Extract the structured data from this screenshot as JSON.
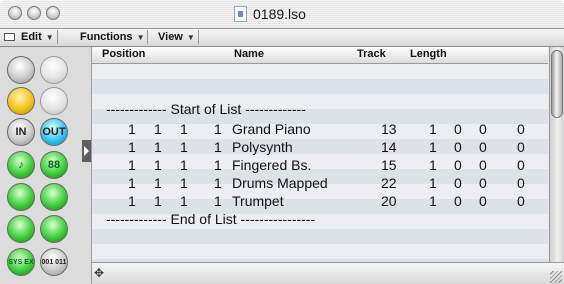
{
  "window": {
    "title": "0189.lso"
  },
  "menubar": {
    "items": [
      {
        "label": "Edit"
      },
      {
        "label": "Functions"
      },
      {
        "label": "View"
      }
    ]
  },
  "toolbar": {
    "buttons": [
      {
        "name": "walk-icon",
        "label": "",
        "color": "gray"
      },
      {
        "name": "up-arrow-icon",
        "label": "",
        "color": "gray-light"
      },
      {
        "name": "catch-icon",
        "label": "",
        "color": "yellow"
      },
      {
        "name": "down-arrow-icon",
        "label": "",
        "color": "gray-light"
      },
      {
        "name": "midi-in-icon",
        "label": "IN",
        "color": "gray"
      },
      {
        "name": "midi-out-icon",
        "label": "OUT",
        "color": "cyan"
      },
      {
        "name": "note-icon",
        "label": "♪",
        "color": "green"
      },
      {
        "name": "program-icon",
        "label": "88",
        "color": "green"
      },
      {
        "name": "pitchbend-icon",
        "label": "",
        "color": "green"
      },
      {
        "name": "controller-icon",
        "label": "",
        "color": "green"
      },
      {
        "name": "aftertouch-icon",
        "label": "",
        "color": "green"
      },
      {
        "name": "polypressure-icon",
        "label": "",
        "color": "green"
      },
      {
        "name": "sysex-icon",
        "label": "SYS EX",
        "color": "green"
      },
      {
        "name": "binary-icon",
        "label": "001 011",
        "color": "gray"
      }
    ]
  },
  "header": {
    "position": "Position",
    "name": "Name",
    "track": "Track",
    "length": "Length"
  },
  "list": {
    "start": "------------- Start of List -------------",
    "end": "------------- End of List ----------------",
    "rows": [
      {
        "bar": "1",
        "beat": "1",
        "div": "1",
        "tick": "1",
        "name": "Grand Piano",
        "track": "13",
        "l1": "1",
        "l2": "0",
        "l3": "0",
        "l4": "0"
      },
      {
        "bar": "1",
        "beat": "1",
        "div": "1",
        "tick": "1",
        "name": "Polysynth",
        "track": "14",
        "l1": "1",
        "l2": "0",
        "l3": "0",
        "l4": "0"
      },
      {
        "bar": "1",
        "beat": "1",
        "div": "1",
        "tick": "1",
        "name": "Fingered Bs.",
        "track": "15",
        "l1": "1",
        "l2": "0",
        "l3": "0",
        "l4": "0"
      },
      {
        "bar": "1",
        "beat": "1",
        "div": "1",
        "tick": "1",
        "name": "Drums Mapped",
        "track": "22",
        "l1": "1",
        "l2": "0",
        "l3": "0",
        "l4": "0"
      },
      {
        "bar": "1",
        "beat": "1",
        "div": "1",
        "tick": "1",
        "name": "Trumpet",
        "track": "20",
        "l1": "1",
        "l2": "0",
        "l3": "0",
        "l4": "0"
      }
    ]
  }
}
